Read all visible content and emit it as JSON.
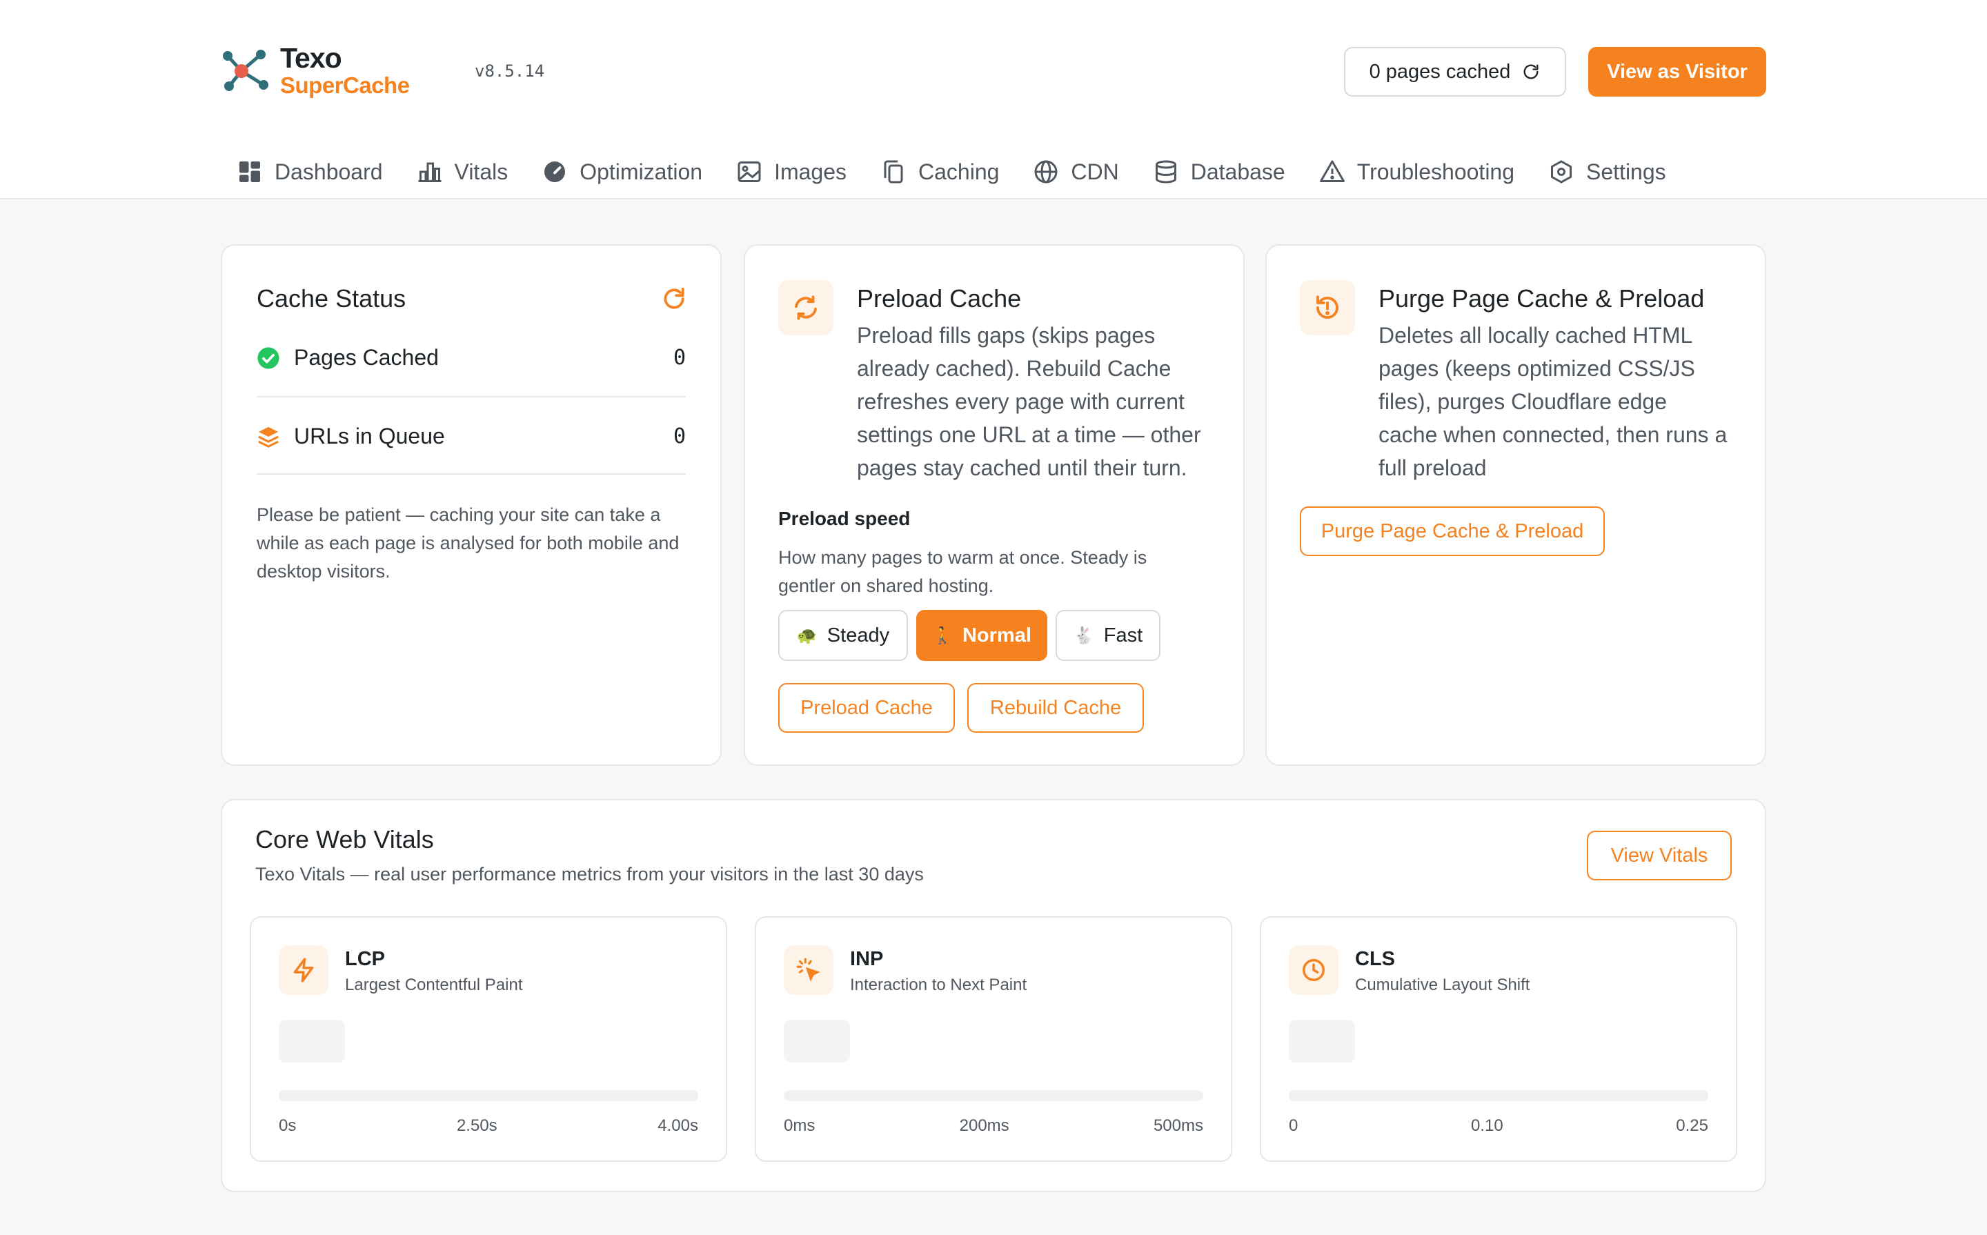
{
  "header": {
    "brand_line1": "Texo",
    "brand_line2": "SuperCache",
    "version": "v8.5.14",
    "pages_cached_label": "0 pages cached",
    "view_visitor_label": "View as Visitor"
  },
  "nav": {
    "items": [
      {
        "label": "Dashboard",
        "icon": "dashboard-icon"
      },
      {
        "label": "Vitals",
        "icon": "bar-chart-icon"
      },
      {
        "label": "Optimization",
        "icon": "gauge-icon"
      },
      {
        "label": "Images",
        "icon": "image-icon"
      },
      {
        "label": "Caching",
        "icon": "copy-icon"
      },
      {
        "label": "CDN",
        "icon": "globe-icon"
      },
      {
        "label": "Database",
        "icon": "database-icon"
      },
      {
        "label": "Troubleshooting",
        "icon": "warning-icon"
      },
      {
        "label": "Settings",
        "icon": "hexagon-settings-icon"
      }
    ]
  },
  "cache_status": {
    "title": "Cache Status",
    "pages_cached_label": "Pages Cached",
    "pages_cached_value": "0",
    "urls_queue_label": "URLs in Queue",
    "urls_queue_value": "0",
    "note": "Please be patient — caching your site can take a while as each page is analysed for both mobile and desktop visitors."
  },
  "preload": {
    "title": "Preload Cache",
    "description": "Preload fills gaps (skips pages already cached). Rebuild Cache refreshes every page with current settings one URL at a time — other pages stay cached until their turn.",
    "speed_title": "Preload speed",
    "speed_desc": "How many pages to warm at once. Steady is gentler on shared hosting.",
    "speeds": [
      {
        "label": "Steady",
        "glyph": "🐢",
        "active": false
      },
      {
        "label": "Normal",
        "glyph": "🚶",
        "active": true
      },
      {
        "label": "Fast",
        "glyph": "🐇",
        "active": false
      }
    ],
    "preload_button": "Preload Cache",
    "rebuild_button": "Rebuild Cache"
  },
  "purge": {
    "title": "Purge Page Cache & Preload",
    "description": "Deletes all locally cached HTML pages (keeps optimized CSS/JS files), purges Cloudflare edge cache when connected, then runs a full preload",
    "button": "Purge Page Cache & Preload"
  },
  "vitals": {
    "title": "Core Web Vitals",
    "subtitle": "Texo Vitals — real user performance metrics from your visitors in the last 30 days",
    "view_button": "View Vitals",
    "metrics": [
      {
        "name": "LCP",
        "full": "Largest Contentful Paint",
        "icon": "lightning-icon",
        "ticks": [
          "0s",
          "2.50s",
          "4.00s"
        ]
      },
      {
        "name": "INP",
        "full": "Interaction to Next Paint",
        "icon": "pointer-click-icon",
        "ticks": [
          "0ms",
          "200ms",
          "500ms"
        ]
      },
      {
        "name": "CLS",
        "full": "Cumulative Layout Shift",
        "icon": "clock-icon",
        "ticks": [
          "0",
          "0.10",
          "0.25"
        ]
      }
    ]
  },
  "colors": {
    "accent": "#f5821f",
    "success": "#22c55e",
    "text": "#1d2327",
    "muted": "#50575e"
  }
}
